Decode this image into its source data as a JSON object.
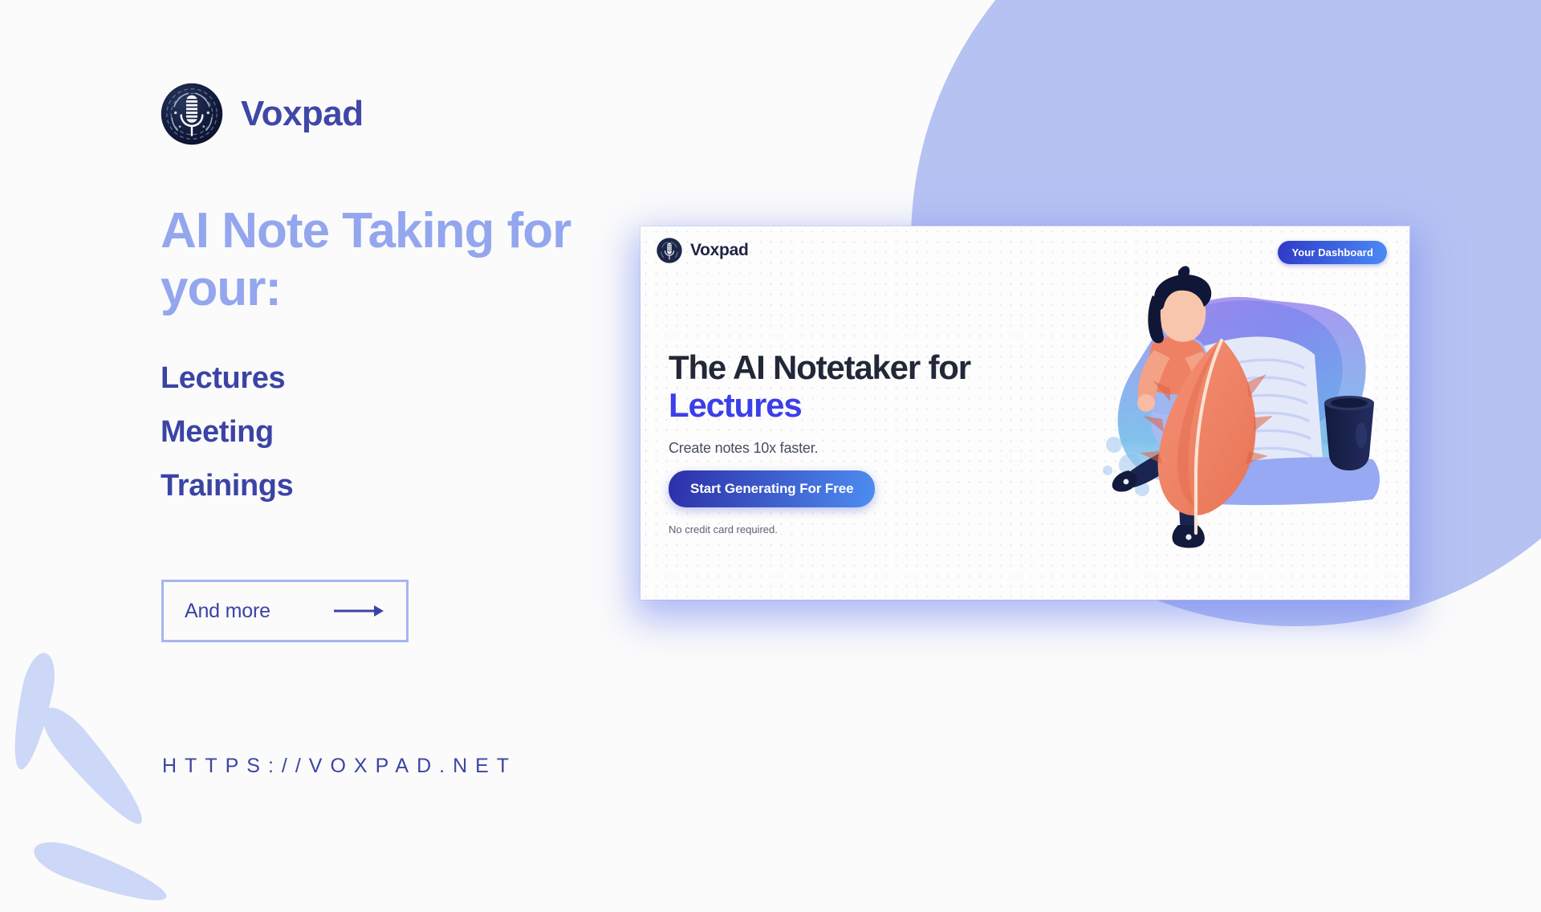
{
  "colors": {
    "page_background": "#FBFBFB",
    "headline": "#93A6EE",
    "brand_navy": "#3F47A8",
    "list_navy": "#3B44A5",
    "accent_blue": "#3B3FE8",
    "blob_periwinkle": "#B6C2F2",
    "comet_periwinkle": "#CDD7F7",
    "card_headline_dark": "#222838",
    "cta_gradient_start": "#2C2FA8",
    "cta_gradient_end": "#4D8DF2"
  },
  "brand": {
    "name": "Voxpad",
    "logo_icon": "microphone-circle-icon"
  },
  "hero": {
    "headline": "AI Note Taking for your:",
    "use_cases": [
      {
        "label": "Lectures"
      },
      {
        "label": "Meeting"
      },
      {
        "label": "Trainings"
      }
    ],
    "cta": {
      "label": "And more",
      "icon": "arrow-right-icon"
    },
    "url": "HTTPS://VOXPAD.NET"
  },
  "product_card": {
    "brand_name": "Voxpad",
    "brand_logo_icon": "microphone-circle-icon",
    "dashboard_button": "Your Dashboard",
    "headline_line1": "The AI Notetaker for",
    "headline_line2": "Lectures",
    "subtitle": "Create notes 10x faster.",
    "primary_button": "Start Generating For Free",
    "disclaimer": "No credit card required.",
    "illustration": "person-with-quill-feather-scroll-inkpot-illustration"
  }
}
